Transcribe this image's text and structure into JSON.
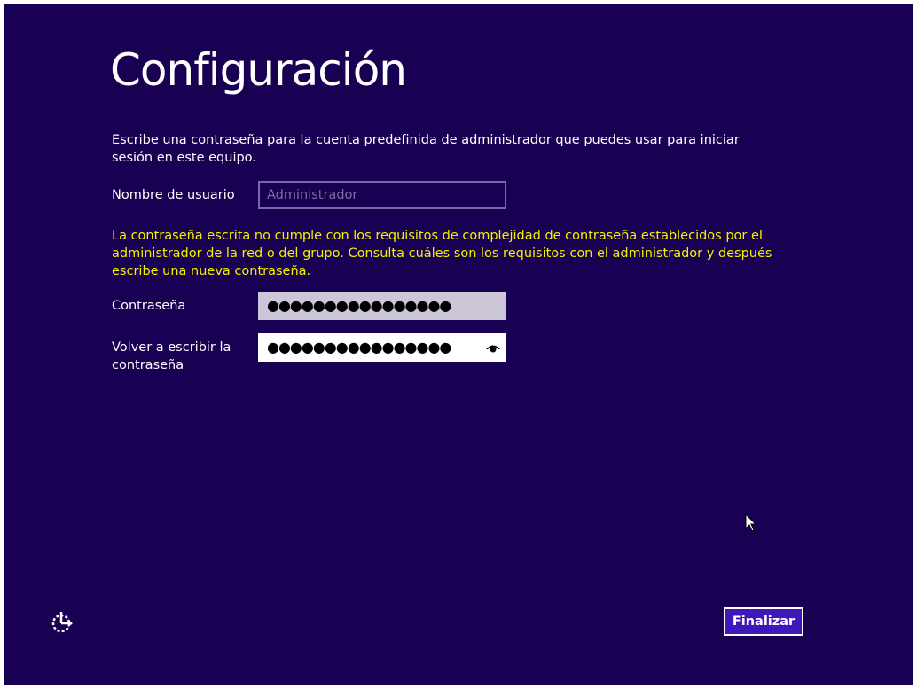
{
  "header": {
    "title": "Configuración"
  },
  "intro": {
    "text": "Escribe una contraseña para la cuenta predefinida de administrador que puedes usar para iniciar sesión en este equipo."
  },
  "username": {
    "label": "Nombre de usuario",
    "value": "Administrador"
  },
  "warning": {
    "text": "La contraseña escrita no cumple con los requisitos de complejidad de contraseña establecidos por el administrador de la red o del grupo. Consulta cuáles son los requisitos con el administrador y después escribe una nueva contraseña."
  },
  "password": {
    "label": "Contraseña",
    "masked": "●●●●●●●●●●●●●●●●"
  },
  "confirm": {
    "label": "Volver a escribir la contraseña",
    "masked": "●●●●●●●●●●●●●●●●"
  },
  "buttons": {
    "finish": "Finalizar"
  },
  "icons": {
    "accessibility": "ease-of-access-icon",
    "reveal": "eye-icon",
    "cursor": "mouse-pointer-icon"
  },
  "colors": {
    "background": "#180052",
    "warning": "#f2f200",
    "button": "#3e18b8"
  }
}
